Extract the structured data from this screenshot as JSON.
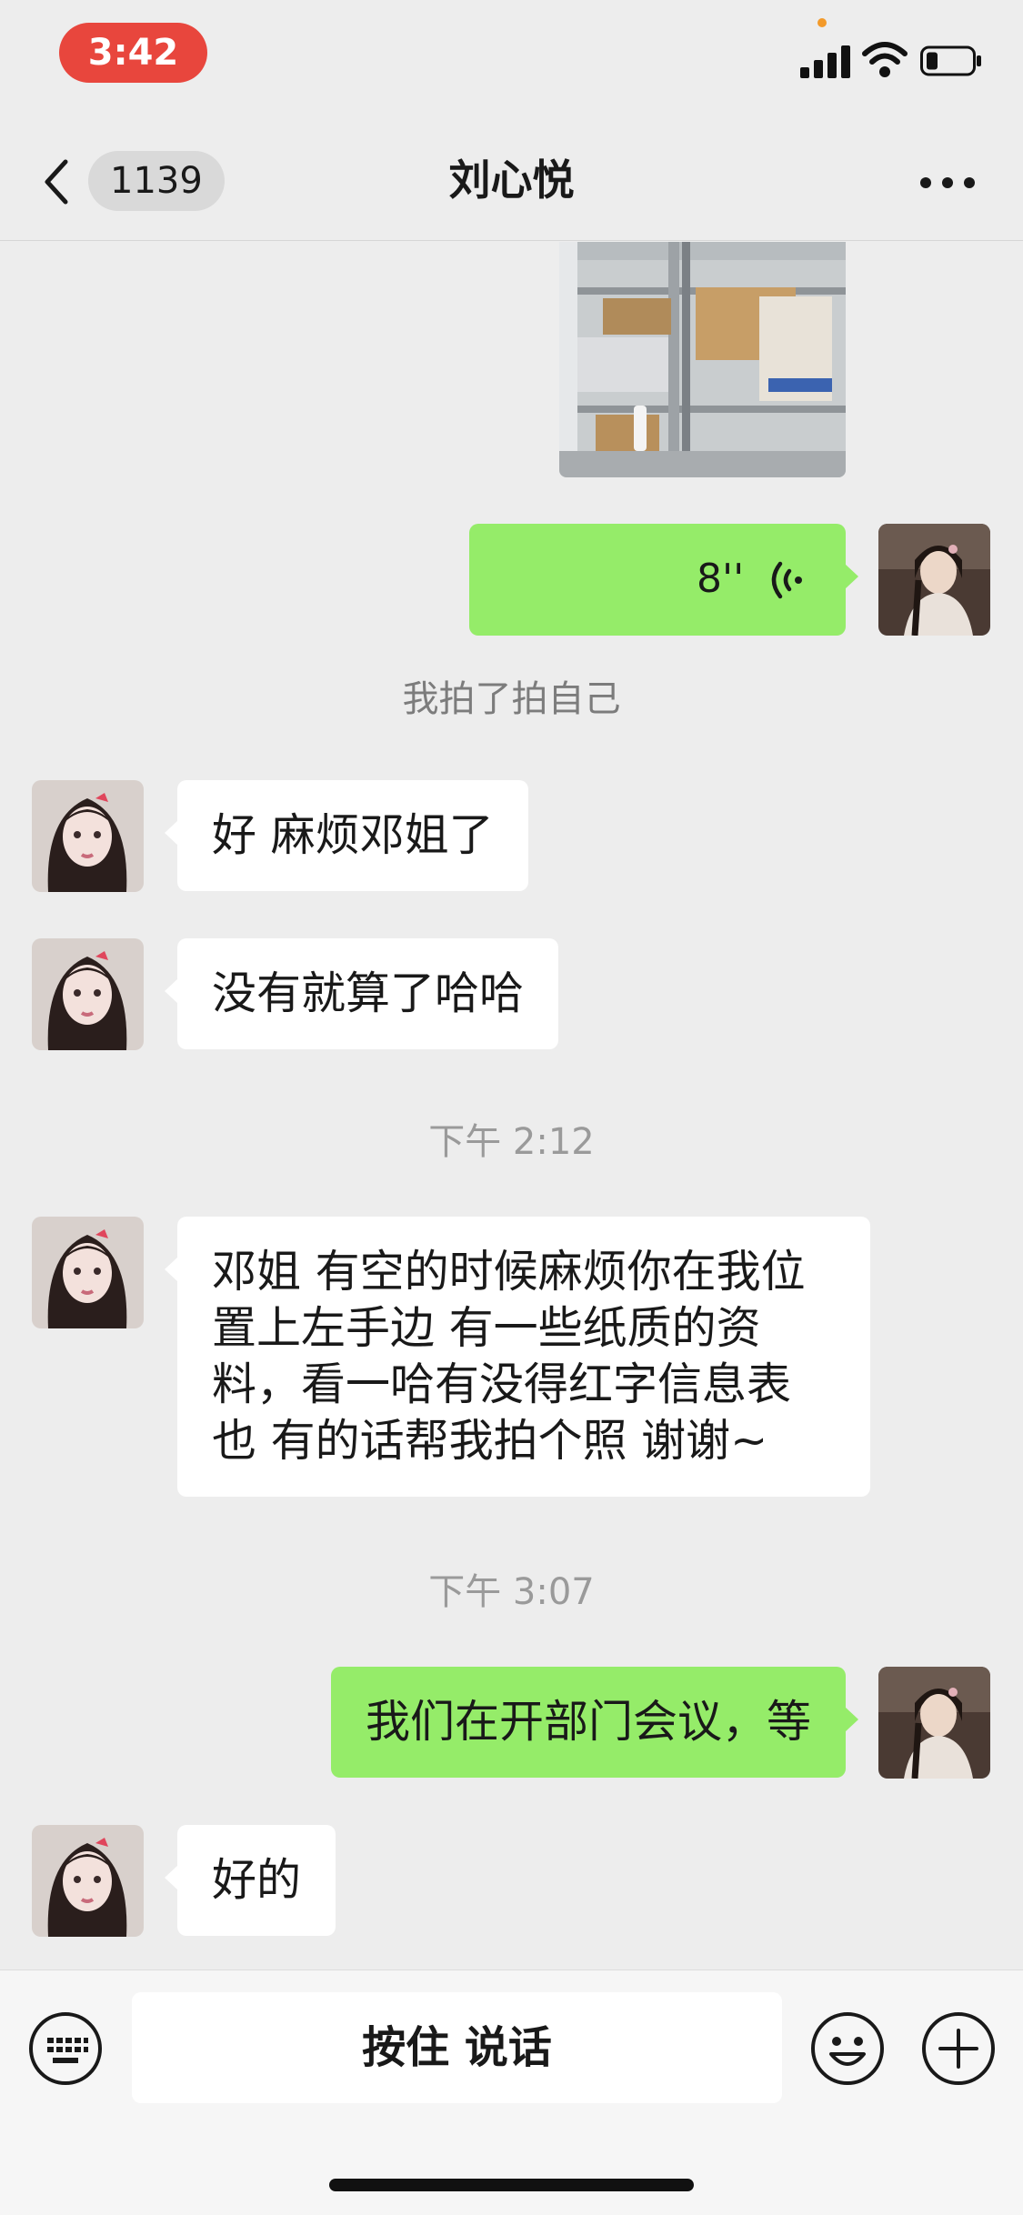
{
  "status_bar": {
    "time": "3:42",
    "time_pill_color": "#e8463d",
    "icons": [
      "signal-icon",
      "wifi-icon",
      "battery-icon"
    ]
  },
  "nav": {
    "unread_count": "1139",
    "title": "刘心悦",
    "icons": [
      "back-icon",
      "more-icon"
    ]
  },
  "messages": [
    {
      "type": "image",
      "side": "right",
      "alt": ""
    },
    {
      "type": "voice",
      "side": "right",
      "duration": "8''"
    },
    {
      "type": "system",
      "text": "我拍了拍自己"
    },
    {
      "type": "text",
      "side": "left",
      "text": "好 麻烦邓姐了"
    },
    {
      "type": "text",
      "side": "left",
      "text": "没有就算了哈哈"
    },
    {
      "type": "timestamp",
      "text": "下午 2:12"
    },
    {
      "type": "text",
      "side": "left",
      "lines": [
        "邓姐 有空的时候麻烦你在我位",
        "置上左手边 有一些纸质的资",
        "料，看一哈有没得红字信息表",
        "也 有的话帮我拍个照 谢谢~"
      ]
    },
    {
      "type": "timestamp",
      "text": "下午 3:07"
    },
    {
      "type": "text",
      "side": "right",
      "text": "我们在开部门会议，等"
    },
    {
      "type": "text",
      "side": "left",
      "text": "好的"
    }
  ],
  "input_bar": {
    "hold_to_talk_label": "按住 说话",
    "icons": [
      "keyboard-icon",
      "emoji-icon",
      "plus-icon"
    ]
  },
  "colors": {
    "background": "#ededed",
    "sent_bubble": "#95ec69",
    "received_bubble": "#ffffff"
  }
}
